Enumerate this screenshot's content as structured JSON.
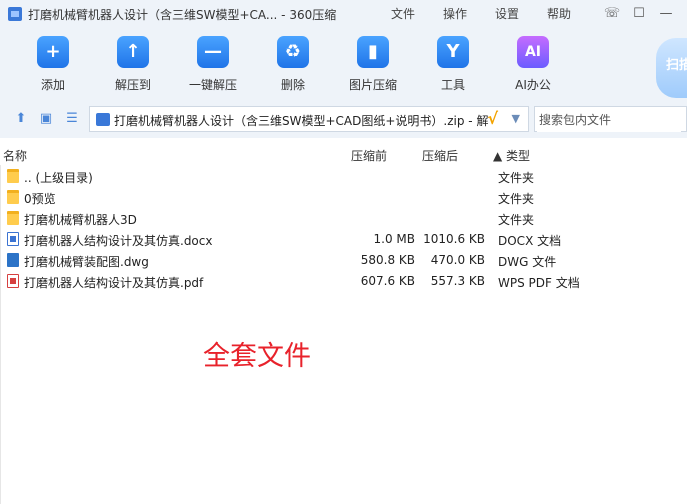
{
  "window": {
    "title": "打磨机械臂机器人设计（含三维SW模型+CA... - 360压缩",
    "menu": [
      "文件",
      "操作",
      "设置",
      "帮助"
    ],
    "controls": [
      "☏",
      "☐",
      "—"
    ]
  },
  "toolbar": {
    "items": [
      {
        "label": "添加",
        "icon": "add-icon",
        "glyph": "+"
      },
      {
        "label": "解压到",
        "icon": "extract-to-icon",
        "glyph": "↑"
      },
      {
        "label": "一键解压",
        "icon": "one-click-extract-icon",
        "glyph": "—"
      },
      {
        "label": "删除",
        "icon": "delete-icon",
        "glyph": "♻"
      },
      {
        "label": "图片压缩",
        "icon": "image-compress-icon",
        "glyph": "▮"
      },
      {
        "label": "工具",
        "icon": "tools-icon",
        "glyph": "Y"
      },
      {
        "label": "AI办公",
        "icon": "ai-office-icon",
        "glyph": "AI"
      }
    ],
    "scan_label": "扫描"
  },
  "address": {
    "path": "打磨机械臂机器人设计（含三维SW模型+CAD图纸+说明书）.zip - 解",
    "search_placeholder": "搜索包内文件"
  },
  "columns": {
    "name": "名称",
    "compressed": "压缩前",
    "original": "压缩后",
    "type": "▲ 类型"
  },
  "files": [
    {
      "name": ".. (上级目录)",
      "compressed": "",
      "original": "",
      "type": "文件夹",
      "kind": "folder"
    },
    {
      "name": "0预览",
      "compressed": "",
      "original": "",
      "type": "文件夹",
      "kind": "folder"
    },
    {
      "name": "打磨机械臂机器人3D",
      "compressed": "",
      "original": "",
      "type": "文件夹",
      "kind": "folder"
    },
    {
      "name": "打磨机器人结构设计及其仿真.docx",
      "compressed": "1.0 MB",
      "original": "1010.6 KB",
      "type": "DOCX 文档",
      "kind": "docx"
    },
    {
      "name": "打磨机械臂装配图.dwg",
      "compressed": "580.8 KB",
      "original": "470.0 KB",
      "type": "DWG 文件",
      "kind": "dwg"
    },
    {
      "name": "打磨机器人结构设计及其仿真.pdf",
      "compressed": "607.6 KB",
      "original": "557.3 KB",
      "type": "WPS PDF 文档",
      "kind": "pdf"
    }
  ],
  "overlay_text": "全套文件",
  "colors": {
    "accent": "#1f74e8",
    "toolbar_bg": "#eef3f9",
    "overlay": "#e8222b"
  }
}
